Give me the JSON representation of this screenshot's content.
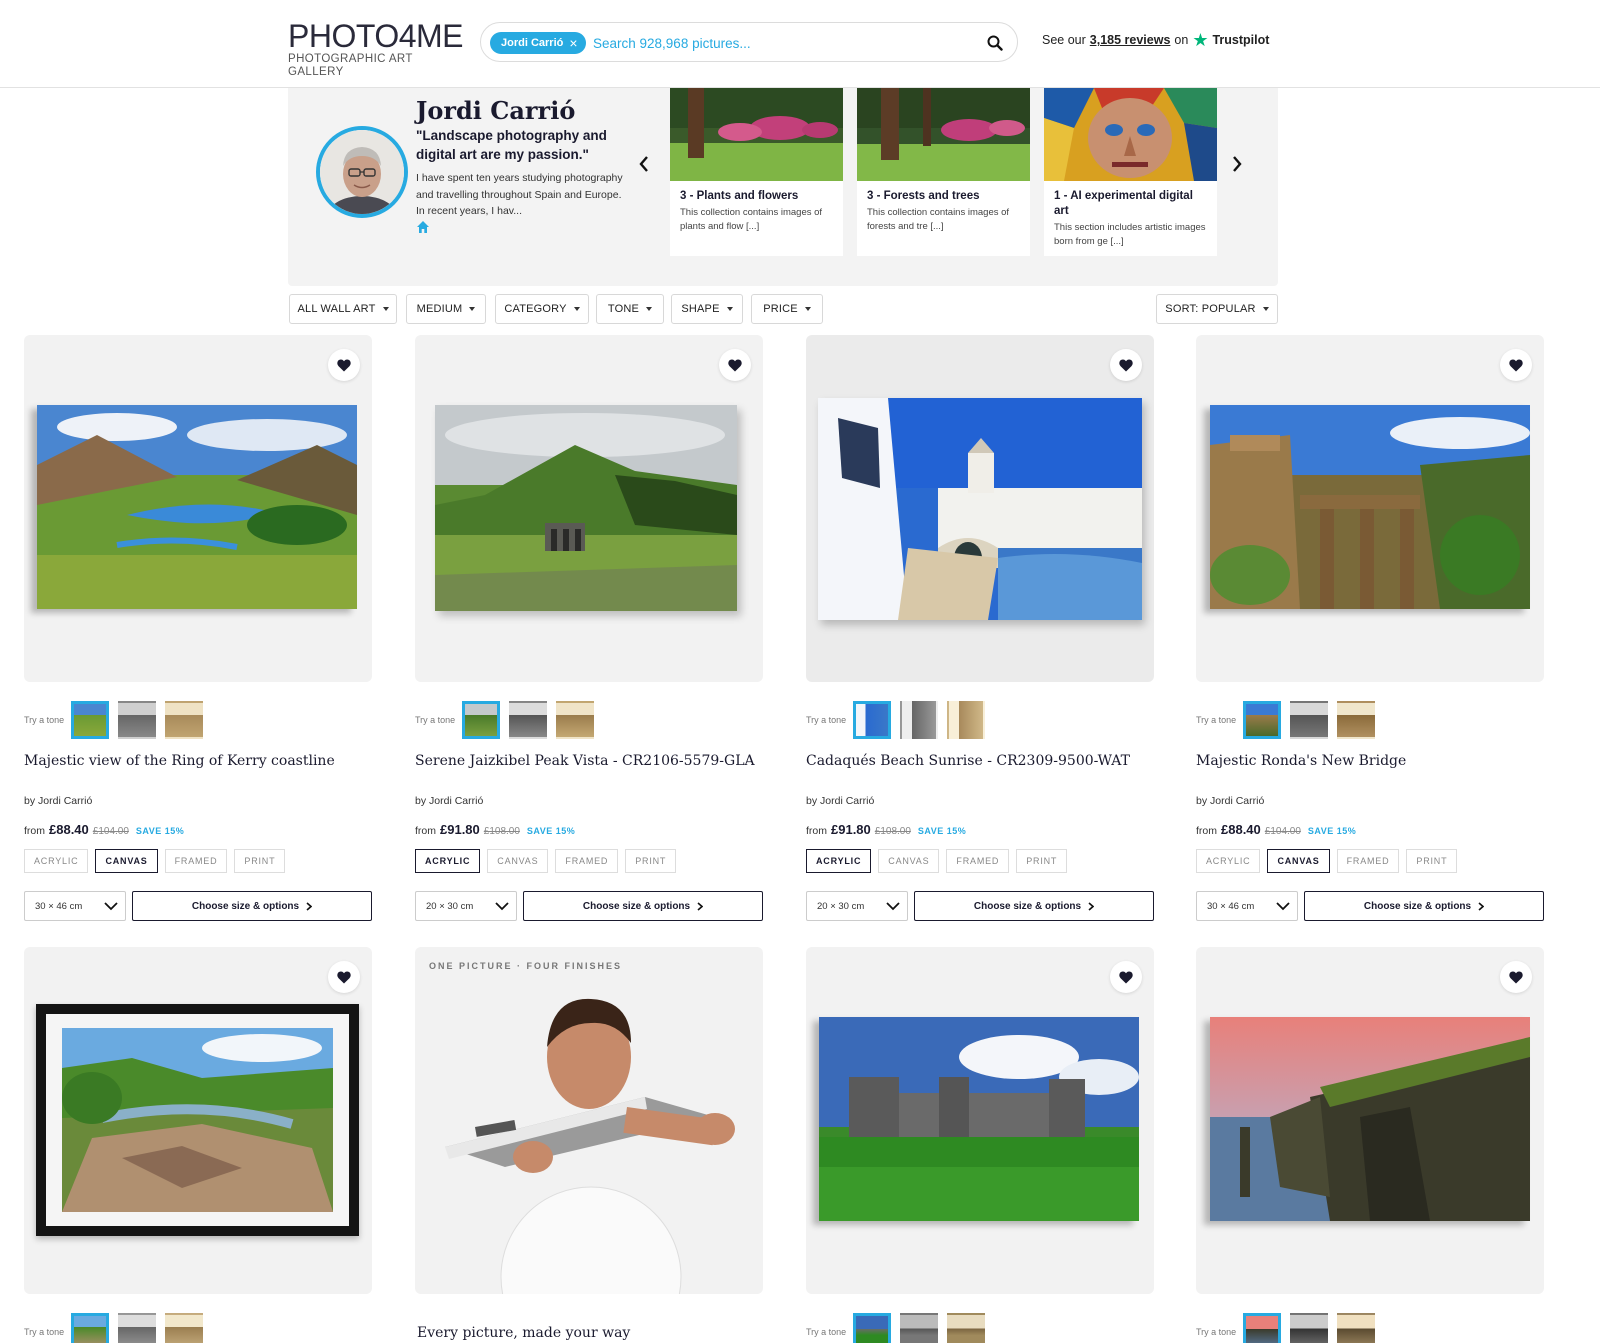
{
  "header": {
    "logo_main": "PHOTO4ME",
    "logo_sub": "PHOTOGRAPHIC ART GALLERY",
    "search_chip": "Jordi Carrió",
    "search_placeholder": "Search 928,968 pictures...",
    "trust_prefix": "See our",
    "trust_link": "3,185 reviews",
    "trust_on": "on",
    "trust_brand": "Trustpilot"
  },
  "artist": {
    "name": "Jordi Carrió",
    "quote": "\"Landscape photography and digital art are my passion.\"",
    "bio": "I have spent ten years studying photography and travelling throughout Spain and Europe. In recent years, I hav..."
  },
  "collections": [
    {
      "title": "3 - Plants and flowers",
      "desc": "This collection contains images of plants and flow [...]"
    },
    {
      "title": "3 - Forests and trees",
      "desc": "This collection contains images of forests and tre [...]"
    },
    {
      "title": "1 - AI experimental digital art",
      "desc": "This section includes artistic images born from ge [...]"
    }
  ],
  "filters": {
    "all_wall_art": "ALL WALL ART",
    "medium": "MEDIUM",
    "category": "CATEGORY",
    "tone": "TONE",
    "shape": "SHAPE",
    "price": "PRICE",
    "sort": "SORT: POPULAR"
  },
  "common": {
    "try_tone": "Try a tone",
    "by_prefix": "by",
    "from_prefix": "from",
    "finishes": [
      "ACRYLIC",
      "CANVAS",
      "FRAMED",
      "PRINT"
    ],
    "choose_btn": "Choose size & options"
  },
  "products": [
    {
      "title": "Majestic view of the Ring of Kerry coastline",
      "artist": "Jordi Carrió",
      "price": "£88.40",
      "was": "£104.00",
      "save": "SAVE 15%",
      "finish": "CANVAS",
      "size": "30 × 46 cm"
    },
    {
      "title": "Serene Jaizkibel Peak Vista - CR2106-5579-GLA",
      "artist": "Jordi Carrió",
      "price": "£91.80",
      "was": "£108.00",
      "save": "SAVE 15%",
      "finish": "ACRYLIC",
      "size": "20 × 30 cm"
    },
    {
      "title": "Cadaqués Beach Sunrise - CR2309-9500-WAT",
      "artist": "Jordi Carrió",
      "price": "£91.80",
      "was": "£108.00",
      "save": "SAVE 15%",
      "finish": "ACRYLIC",
      "size": "20 × 30 cm"
    },
    {
      "title": "Majestic Ronda's New Bridge",
      "artist": "Jordi Carrió",
      "price": "£88.40",
      "was": "£104.00",
      "save": "SAVE 15%",
      "finish": "CANVAS",
      "size": "30 × 46 cm"
    }
  ],
  "promo": {
    "label": "ONE PICTURE · FOUR FINISHES",
    "title": "Every picture, made your way"
  },
  "colors": {
    "accent": "#27aae1",
    "navy": "#1a1a2e",
    "trustpilot": "#00b67a"
  }
}
